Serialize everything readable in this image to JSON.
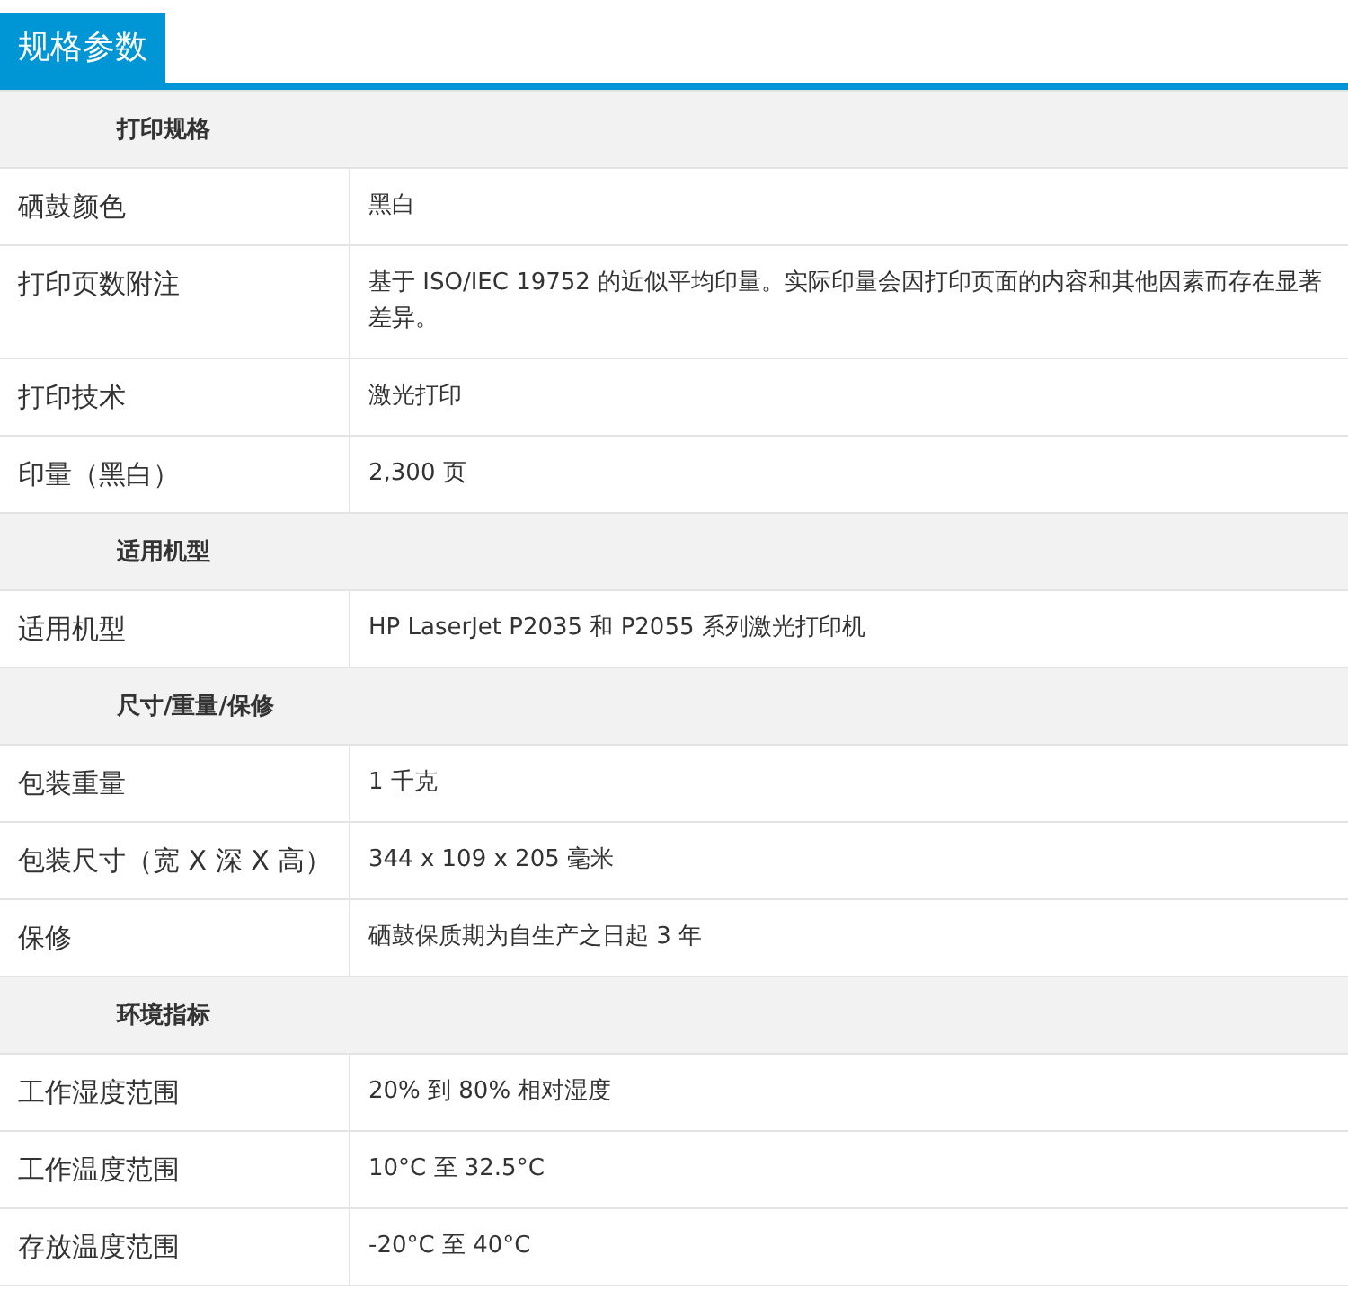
{
  "tab": {
    "label": "规格参数",
    "selected": true
  },
  "sections": [
    {
      "title": "打印规格",
      "rows": [
        {
          "label": "硒鼓颜色",
          "value": "黑白"
        },
        {
          "label": "打印页数附注",
          "value": "基于 ISO/IEC 19752 的近似平均印量。实际印量会因打印页面的内容和其他因素而存在显著差异。"
        },
        {
          "label": "打印技术",
          "value": "激光打印"
        },
        {
          "label": "印量（黑白）",
          "value": "2,300 页"
        }
      ]
    },
    {
      "title": "适用机型",
      "rows": [
        {
          "label": "适用机型",
          "value": "HP LaserJet P2035 和 P2055 系列激光打印机"
        }
      ]
    },
    {
      "title": "尺寸/重量/保修",
      "rows": [
        {
          "label": "包装重量",
          "value": "1 千克"
        },
        {
          "label": "包装尺寸（宽 X 深 X 高）",
          "value": "344 x 109 x 205 毫米"
        },
        {
          "label": "保修",
          "value": "硒鼓保质期为自生产之日起 3 年"
        }
      ]
    },
    {
      "title": "环境指标",
      "rows": [
        {
          "label": "工作湿度范围",
          "value": "20% 到 80% 相对湿度"
        },
        {
          "label": "工作温度范围",
          "value": "10°C 至 32.5°C"
        },
        {
          "label": "存放温度范围",
          "value": "-20°C 至 40°C"
        }
      ]
    }
  ]
}
